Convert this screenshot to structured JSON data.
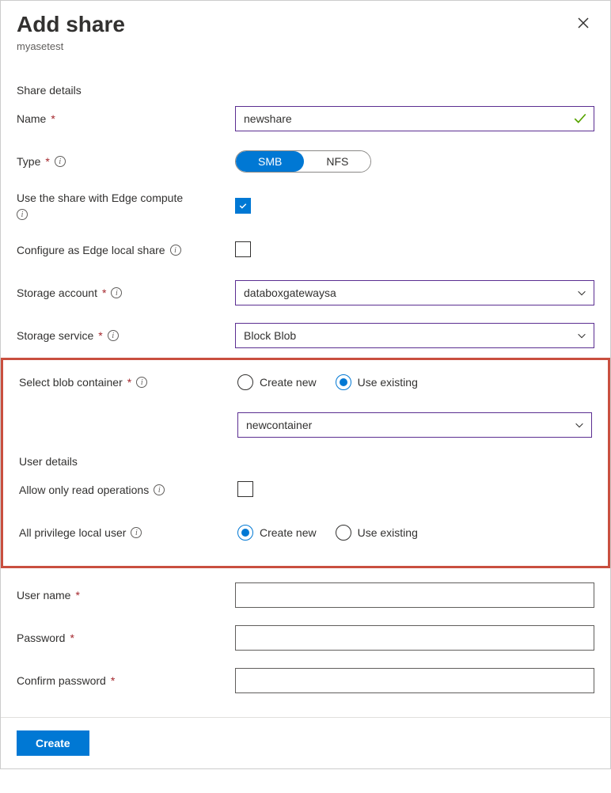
{
  "header": {
    "title": "Add share",
    "subtitle": "myasetest"
  },
  "sections": {
    "share_details": "Share details",
    "user_details": "User details"
  },
  "shareDetails": {
    "name": {
      "label": "Name",
      "value": "newshare"
    },
    "type": {
      "label": "Type",
      "options": [
        "SMB",
        "NFS"
      ],
      "selected": "SMB"
    },
    "edgeCompute": {
      "label": "Use the share with Edge compute",
      "checked": true
    },
    "edgeLocal": {
      "label": "Configure as Edge local share",
      "checked": false
    },
    "storageAccount": {
      "label": "Storage account",
      "value": "databoxgatewaysa"
    },
    "storageService": {
      "label": "Storage service",
      "value": "Block Blob"
    },
    "blobContainer": {
      "label": "Select blob container",
      "options": {
        "create": "Create new",
        "existing": "Use existing"
      },
      "selected": "existing",
      "value": "newcontainer"
    }
  },
  "userDetails": {
    "readOnly": {
      "label": "Allow only read operations",
      "checked": false
    },
    "privilegeUser": {
      "label": "All privilege local user",
      "options": {
        "create": "Create new",
        "existing": "Use existing"
      },
      "selected": "create"
    },
    "userName": {
      "label": "User name",
      "value": ""
    },
    "password": {
      "label": "Password",
      "value": ""
    },
    "confirmPassword": {
      "label": "Confirm password",
      "value": ""
    }
  },
  "footer": {
    "createButton": "Create"
  }
}
